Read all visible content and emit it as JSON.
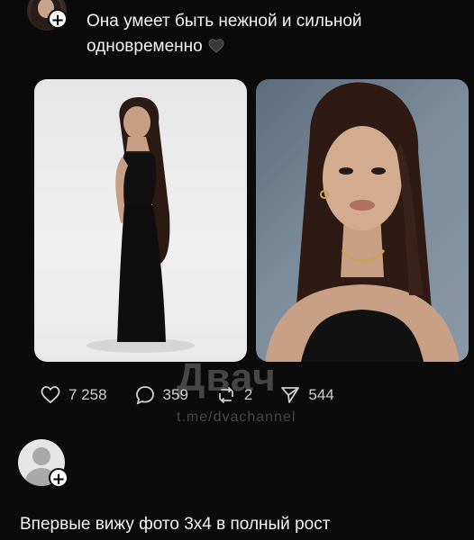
{
  "post": {
    "caption_line1": "Она умеет быть нежной и сильной",
    "caption_line2": "одновременно",
    "caption_emoji": "black-heart-emoji"
  },
  "photos": [
    {
      "name": "full-length-photo",
      "desc_icon": "photo-image"
    },
    {
      "name": "portrait-photo",
      "desc_icon": "photo-image"
    }
  ],
  "actions": {
    "likes": "7 258",
    "comments": "359",
    "reposts": "2",
    "shares": "544"
  },
  "watermark": {
    "main": "Двач",
    "sub": "t.me/dvachannel"
  },
  "comment": {
    "text": "Впервые вижу фото 3х4 в полный рост"
  },
  "colors": {
    "background": "#0b0b0b",
    "text": "#f2f2f2",
    "icon": "#cfcfcf"
  }
}
